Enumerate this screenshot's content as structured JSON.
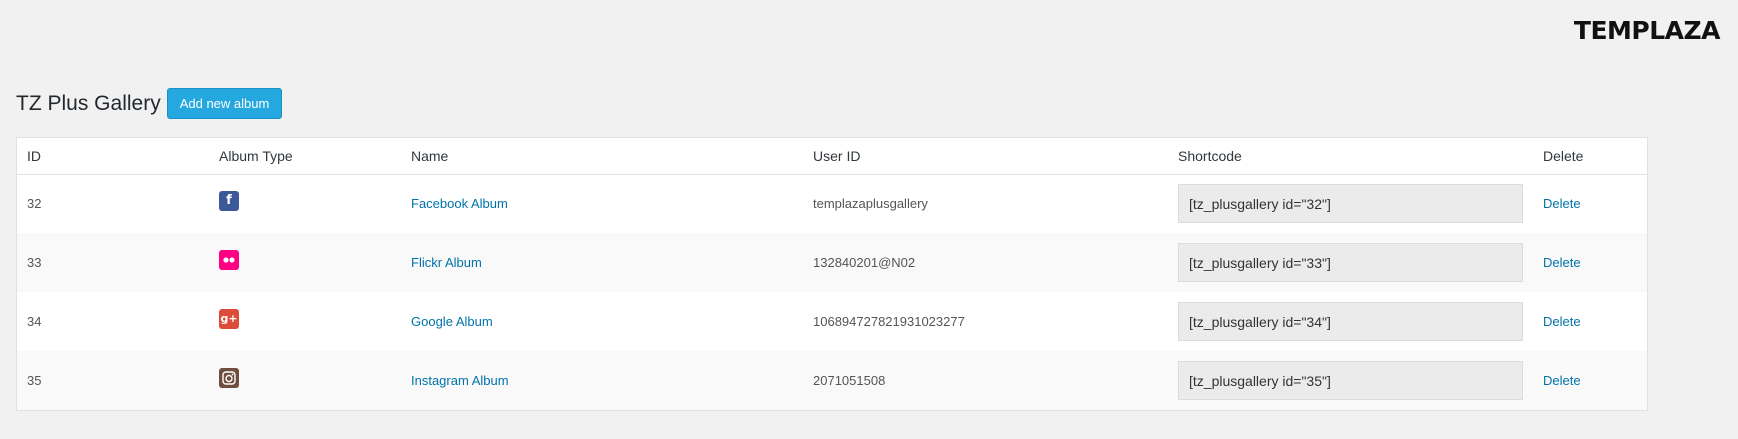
{
  "brand": {
    "logo_text": "TEMPLAZA"
  },
  "header": {
    "title": "TZ Plus Gallery",
    "add_button_label": "Add new album"
  },
  "table": {
    "columns": [
      "ID",
      "Album Type",
      "Name",
      "User ID",
      "Shortcode",
      "Delete"
    ],
    "rows": [
      {
        "id": "32",
        "type_icon": "facebook-icon",
        "name": "Facebook Album",
        "user_id": "templazaplusgallery",
        "shortcode": "[tz_plusgallery id=\"32\"]",
        "delete_label": "Delete"
      },
      {
        "id": "33",
        "type_icon": "flickr-icon",
        "name": "Flickr Album",
        "user_id": "132840201@N02",
        "shortcode": "[tz_plusgallery id=\"33\"]",
        "delete_label": "Delete"
      },
      {
        "id": "34",
        "type_icon": "google-plus-icon",
        "name": "Google Album",
        "user_id": "106894727821931023277",
        "shortcode": "[tz_plusgallery id=\"34\"]",
        "delete_label": "Delete"
      },
      {
        "id": "35",
        "type_icon": "instagram-icon",
        "name": "Instagram Album",
        "user_id": "2071051508",
        "shortcode": "[tz_plusgallery id=\"35\"]",
        "delete_label": "Delete"
      }
    ]
  },
  "colors": {
    "facebook": "#3b5998",
    "flickr": "#ff0084",
    "google": "#dd4b39",
    "instagram": "#6f4e3f",
    "link": "#0073aa",
    "button": "#25a8e0"
  }
}
